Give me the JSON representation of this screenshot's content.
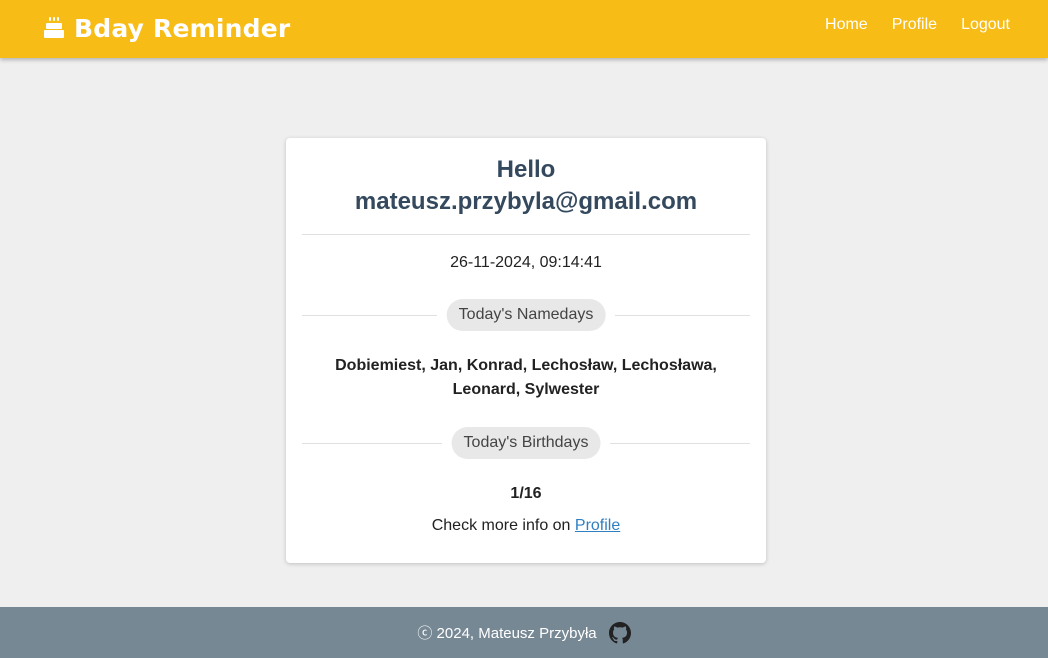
{
  "header": {
    "brand": "Bday Reminder",
    "brand_icon": "cake-icon",
    "nav": [
      {
        "label": "Home"
      },
      {
        "label": "Profile"
      },
      {
        "label": "Logout"
      }
    ]
  },
  "greeting": {
    "hello": "Hello",
    "email": "mateusz.przybyla@gmail.com"
  },
  "datetime": "26-11-2024, 09:14:41",
  "namedays": {
    "title": "Today's Namedays",
    "names_line1": "Dobiemiest, Jan, Konrad, Lechosław, Lechosława,",
    "names_line2": "Leonard, Sylwester"
  },
  "birthdays": {
    "title": "Today's Birthdays",
    "count": "1/16",
    "more_prefix": "Check more info on ",
    "more_link": "Profile"
  },
  "footer": {
    "text": "ⓒ 2024, Mateusz Przybyła",
    "icon": "github-icon"
  },
  "colors": {
    "header_bg": "#f7bc16",
    "footer_bg": "#778895",
    "link": "#2f7fc1",
    "heading": "#34495e"
  }
}
